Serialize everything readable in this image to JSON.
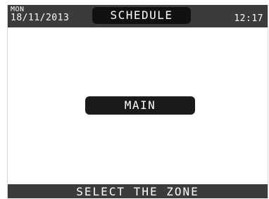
{
  "header": {
    "day": "MON",
    "date": "18/11/2013",
    "title": "SCHEDULE",
    "time": "12:17"
  },
  "main": {
    "zone_button_label": "MAIN"
  },
  "footer": {
    "prompt": "SELECT THE ZONE"
  }
}
